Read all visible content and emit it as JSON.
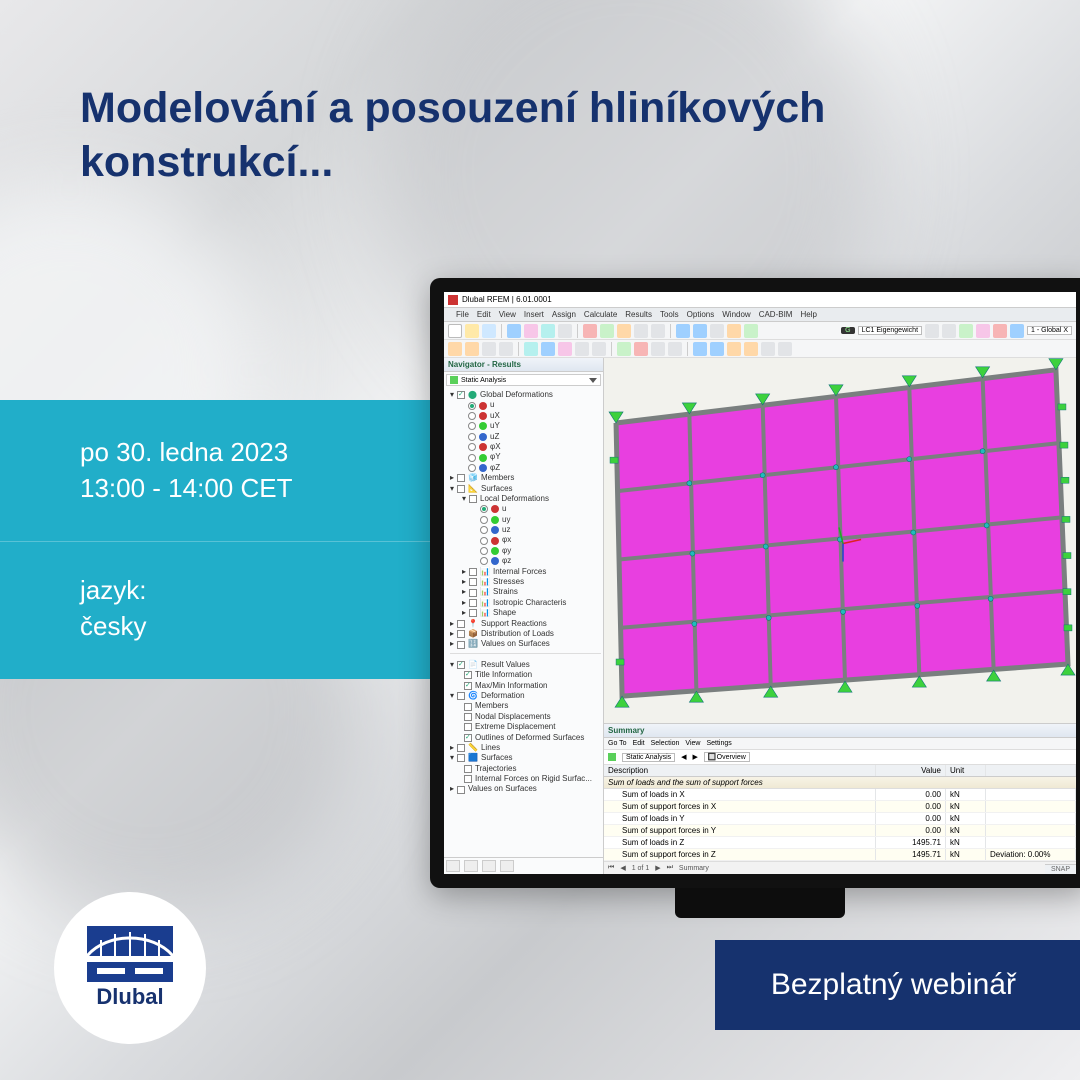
{
  "headline": "Modelování a posouzení hliníkových konstrukcí...",
  "info": {
    "date": "po 30. ledna 2023",
    "time": "13:00 - 14:00 CET",
    "lang_label": "jazyk:",
    "lang": "česky"
  },
  "logo": {
    "text": "Dlubal"
  },
  "cta": "Bezplatný webinář",
  "app": {
    "title": "Dlubal RFEM | 6.01.0001",
    "menu": [
      "File",
      "Edit",
      "View",
      "Insert",
      "Assign",
      "Calculate",
      "Results",
      "Tools",
      "Options",
      "Window",
      "CAD-BIM",
      "Help"
    ],
    "lc_badge": "G",
    "lc_combo": "LC1  Eigengewicht",
    "view_combo": "1 - Global X",
    "nav": {
      "title": "Navigator - Results",
      "analysis": "Static Analysis",
      "tree": {
        "global_def": "Global Deformations",
        "axes": [
          "u",
          "uX",
          "uY",
          "uZ",
          "φX",
          "φY",
          "φZ"
        ],
        "members": "Members",
        "surfaces": "Surfaces",
        "local_def": "Local Deformations",
        "local_axes": [
          "u",
          "uy",
          "uz",
          "φx",
          "φy",
          "φz"
        ],
        "internal_forces": "Internal Forces",
        "stresses": "Stresses",
        "strains": "Strains",
        "iso": "Isotropic Characteris",
        "shape": "Shape",
        "support": "Support Reactions",
        "distribution": "Distribution of Loads",
        "values_surf": "Values on Surfaces",
        "result_values": "Result Values",
        "title_info": "Title Information",
        "maxmin": "Max/Min Information",
        "deformation": "Deformation",
        "members2": "Members",
        "nodal": "Nodal Displacements",
        "extreme": "Extreme Displacement",
        "outlines": "Outlines of Deformed Surfaces",
        "lines": "Lines",
        "surfaces2": "Surfaces",
        "traj": "Trajectories",
        "rigid": "Internal Forces on Rigid Surfac...",
        "vals_surf2": "Values on Surfaces"
      }
    },
    "summary": {
      "title": "Summary",
      "bar": [
        "Go To",
        "Edit",
        "Selection",
        "View",
        "Settings"
      ],
      "combo": "Static Analysis",
      "overview": "Overview",
      "columns": [
        "Description",
        "Value",
        "Unit",
        ""
      ],
      "section": "Sum of loads and the sum of support forces",
      "rows": [
        {
          "d": "Sum of loads in X",
          "v": "0.00",
          "u": "kN",
          "n": ""
        },
        {
          "d": "Sum of support forces in X",
          "v": "0.00",
          "u": "kN",
          "n": ""
        },
        {
          "d": "Sum of loads in Y",
          "v": "0.00",
          "u": "kN",
          "n": ""
        },
        {
          "d": "Sum of support forces in Y",
          "v": "0.00",
          "u": "kN",
          "n": ""
        },
        {
          "d": "Sum of loads in Z",
          "v": "1495.71",
          "u": "kN",
          "n": ""
        },
        {
          "d": "Sum of support forces in Z",
          "v": "1495.71",
          "u": "kN",
          "n": "Deviation: 0.00%"
        }
      ],
      "pager": "1 of 1",
      "pager_label": "Summary"
    },
    "status": "SNAP"
  }
}
